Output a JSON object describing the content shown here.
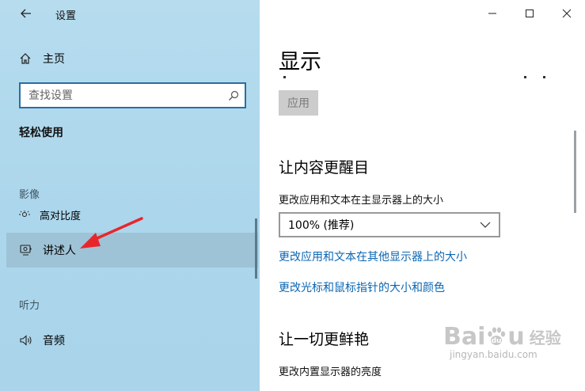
{
  "window": {
    "title": "设置"
  },
  "sidebar": {
    "home_label": "主页",
    "search": {
      "placeholder": "查找设置"
    },
    "section_title": "轻松使用",
    "groups": {
      "vision": "影像",
      "hearing": "听力"
    },
    "items": [
      {
        "label": "高对比度"
      },
      {
        "label": "讲述人"
      },
      {
        "label": "音频"
      }
    ]
  },
  "content": {
    "page_title": "显示",
    "apply_label": "应用",
    "section1": {
      "title": "让内容更醒目",
      "scale_label": "更改应用和文本在主显示器上的大小",
      "scale_value": "100% (推荐)",
      "link_other_displays": "更改应用和文本在其他显示器上的大小",
      "link_cursor": "更改光标和鼠标指针的大小和颜色"
    },
    "section2": {
      "title": "让一切更鲜艳",
      "brightness_label": "更改内置显示器的亮度"
    }
  },
  "watermark": {
    "text": "Bai",
    "text_end": "u",
    "text_cn": "经验",
    "url": "jingyan.baidu.com"
  },
  "colors": {
    "accent": "#0a66b3",
    "annotation_arrow": "#e8262c",
    "sidebar_bg": "#acd6ec"
  }
}
